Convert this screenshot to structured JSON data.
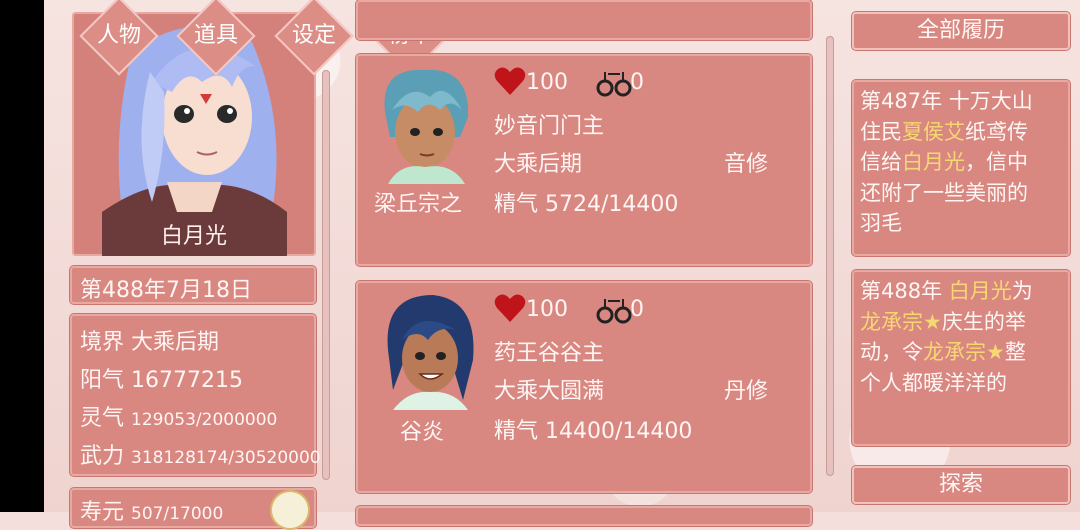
{
  "tabs": [
    "人物",
    "道具",
    "设定",
    "榜单"
  ],
  "player": {
    "name": "白月光",
    "date": "第488年7月18日",
    "realm_label": "境界",
    "realm_value": "大乘后期",
    "yang_label": "阳气",
    "yang_value": "16777215",
    "ling_label": "灵气",
    "ling_value": "129053/2000000",
    "wuli_label": "武力",
    "wuli_value": "318128174/30520000",
    "shouyuan_label": "寿元",
    "shouyuan_value": "507/17000"
  },
  "cards": [
    {
      "name": "梁丘宗之",
      "favor": "100",
      "bond": "0",
      "title": "妙音门门主",
      "realm": "大乘后期",
      "path": "音修",
      "essence_label": "精气",
      "essence": "5724/14400"
    },
    {
      "name": "谷炎",
      "favor": "100",
      "bond": "0",
      "title": "药王谷谷主",
      "realm": "大乘大圆满",
      "path": "丹修",
      "essence_label": "精气",
      "essence": "14400/14400"
    }
  ],
  "log": {
    "header": "全部履历",
    "entry1": {
      "p1": "第487年 十万大山住民",
      "hl1": "夏侯艾",
      "p2": "纸鸢传信给",
      "hl2": "白月光",
      "p3": "，信中还附了一些美丽的羽毛"
    },
    "entry2": {
      "p1": "第488年 ",
      "hl1": "白月光",
      "p2": "为",
      "hl2": "龙承宗★",
      "p3": "庆生的举动，令",
      "hl3": "龙承宗★",
      "p4": "整个人都暖洋洋的"
    },
    "explore_button": "探索"
  },
  "colors": {
    "panel": "#d98781",
    "highlight_text": "#f6d873",
    "heart": "#c0141b"
  }
}
